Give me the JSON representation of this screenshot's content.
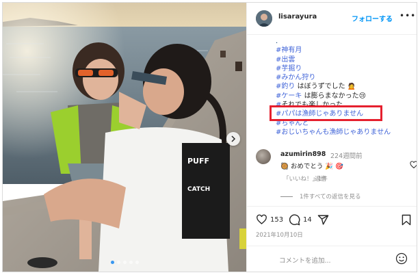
{
  "post": {
    "username": "lisarayura",
    "follow_label": "フォローする",
    "more_label": "•••"
  },
  "caption": {
    "lines": [
      {
        "text": "."
      },
      {
        "text": "#神有月"
      },
      {
        "text": "#出雲"
      },
      {
        "text": "#芋掘り"
      },
      {
        "text": "#みかん狩り"
      },
      {
        "text": "#釣り",
        "suffix": " はぼうずでした 🙍"
      },
      {
        "text": "#ケーキ",
        "suffix": " は膨らまなかった😢"
      },
      {
        "text": "#",
        "suffix": "それでも楽しかった"
      },
      {
        "text": "#パパは漁師じゃありません"
      },
      {
        "text": "#ちゃんと"
      },
      {
        "text": "#おじいちゃんも漁師じゃありません"
      }
    ],
    "highlighted_index": 8
  },
  "comment": {
    "username": "azumirin898",
    "time": "224週間前",
    "text": "🥘 おめでとう 🎉 🎯",
    "likes_label": "「いいね！」1件",
    "reply_label": "返信",
    "view_replies_label": "1件すべての返信を見る"
  },
  "actions": {
    "like_count": "153",
    "comment_count": "14"
  },
  "date": "2021年10月10日",
  "add_comment_placeholder": "コメントを追加...",
  "colors": {
    "accent": "#0095f6",
    "hashtag": "#3f63d8",
    "highlight_box": "#e5202e",
    "carousel_active": "#3897f0"
  }
}
